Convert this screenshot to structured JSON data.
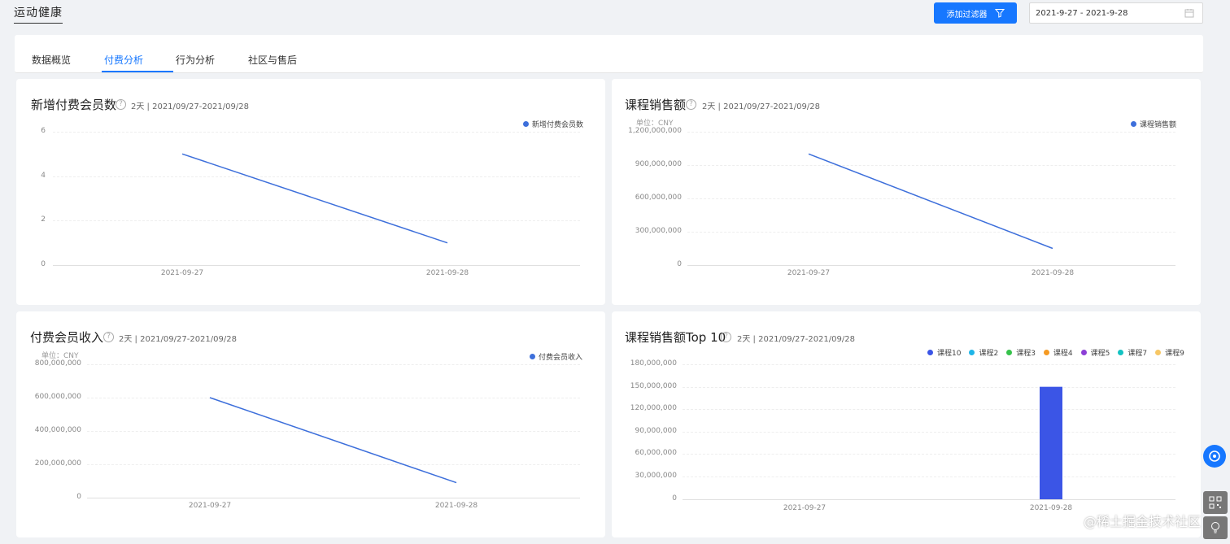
{
  "app": {
    "title": "运动健康"
  },
  "toolbar": {
    "add_filter_label": "添加过滤器",
    "date_range": "2021-9-27 - 2021-9-28"
  },
  "tabs": [
    {
      "label": "数据概览",
      "active": false
    },
    {
      "label": "付费分析",
      "active": true
    },
    {
      "label": "行为分析",
      "active": false
    },
    {
      "label": "社区与售后",
      "active": false
    }
  ],
  "colors": {
    "accent": "#1677ff",
    "line": "#3d6fdb",
    "bar": "#3b55e6"
  },
  "cards": {
    "new_paid_members": {
      "title": "新增付费会员数",
      "meta": "2天 | 2021/09/27-2021/09/28",
      "legend": "新增付费会员数",
      "y_ticks": [
        "6",
        "4",
        "2",
        "0"
      ],
      "x_ticks": [
        "2021-09-27",
        "2021-09-28"
      ]
    },
    "course_sales": {
      "title": "课程销售额",
      "meta": "2天 | 2021/09/27-2021/09/28",
      "unit": "单位：CNY",
      "legend": "课程销售额",
      "y_ticks": [
        "1,200,000,000",
        "900,000,000",
        "600,000,000",
        "300,000,000",
        "0"
      ],
      "x_ticks": [
        "2021-09-27",
        "2021-09-28"
      ]
    },
    "paid_member_income": {
      "title": "付费会员收入",
      "meta": "2天 | 2021/09/27-2021/09/28",
      "unit": "单位：CNY",
      "legend": "付费会员收入",
      "y_ticks": [
        "800,000,000",
        "600,000,000",
        "400,000,000",
        "200,000,000",
        "0"
      ],
      "x_ticks": [
        "2021-09-27",
        "2021-09-28"
      ]
    },
    "course_sales_top10": {
      "title": "课程销售额Top 10",
      "meta": "2天 | 2021/09/27-2021/09/28",
      "legend": [
        {
          "label": "课程10",
          "color": "#3b55e6"
        },
        {
          "label": "课程2",
          "color": "#1fb5e8"
        },
        {
          "label": "课程3",
          "color": "#36c24b"
        },
        {
          "label": "课程4",
          "color": "#f59a23"
        },
        {
          "label": "课程5",
          "color": "#8c3fd6"
        },
        {
          "label": "课程7",
          "color": "#13c2c2"
        },
        {
          "label": "课程9",
          "color": "#f7c765"
        }
      ],
      "y_ticks": [
        "180,000,000",
        "150,000,000",
        "120,000,000",
        "90,000,000",
        "60,000,000",
        "30,000,000",
        "0"
      ],
      "x_ticks": [
        "2021-09-27",
        "2021-09-28"
      ]
    }
  },
  "chart_data": [
    {
      "type": "line",
      "x": [
        "2021-09-27",
        "2021-09-28"
      ],
      "series": [
        {
          "name": "新增付费会员数",
          "values": [
            5,
            1
          ]
        }
      ],
      "ylim": [
        0,
        6
      ]
    },
    {
      "type": "line",
      "x": [
        "2021-09-27",
        "2021-09-28"
      ],
      "series": [
        {
          "name": "课程销售额",
          "values": [
            1000000000,
            150000000
          ]
        }
      ],
      "ylim": [
        0,
        1200000000
      ]
    },
    {
      "type": "line",
      "x": [
        "2021-09-27",
        "2021-09-28"
      ],
      "series": [
        {
          "name": "付费会员收入",
          "values": [
            600000000,
            90000000
          ]
        }
      ],
      "ylim": [
        0,
        800000000
      ]
    },
    {
      "type": "bar",
      "categories": [
        "2021-09-27",
        "2021-09-28"
      ],
      "series": [
        {
          "name": "课程10",
          "values": [
            0,
            150000000
          ]
        }
      ],
      "ylim": [
        0,
        180000000
      ]
    }
  ],
  "watermark": "@稀土掘金技术社区"
}
